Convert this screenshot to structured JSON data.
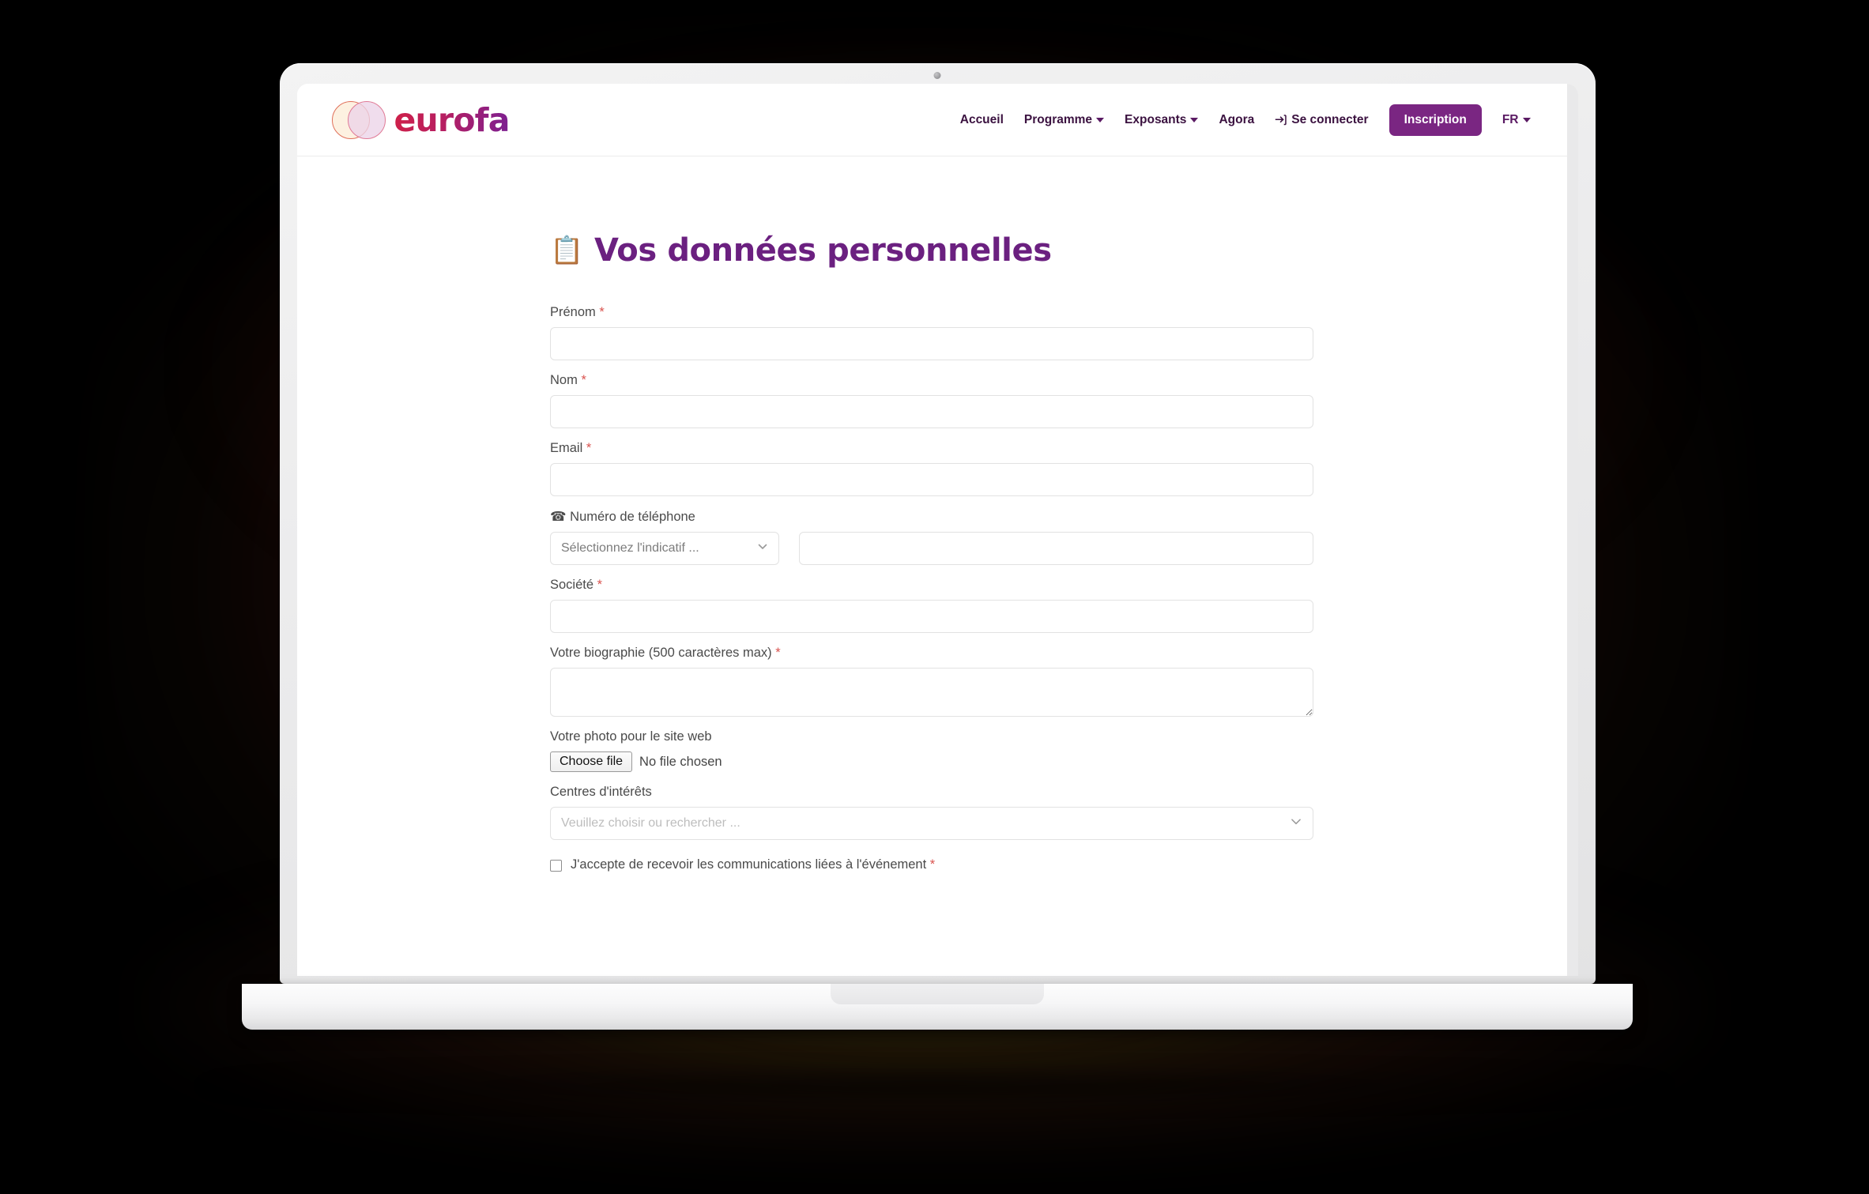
{
  "header": {
    "brand_name": "eurofa",
    "nav": [
      {
        "label": "Accueil",
        "has_caret": false
      },
      {
        "label": "Programme",
        "has_caret": true
      },
      {
        "label": "Exposants",
        "has_caret": true
      },
      {
        "label": "Agora",
        "has_caret": false
      }
    ],
    "signin_label": "Se connecter",
    "register_label": "Inscription",
    "language_label": "FR",
    "accent_color": "#7a2682"
  },
  "main": {
    "title_emoji": "📋",
    "title": "Vos données personnelles",
    "title_color": "#6b2080",
    "required_mark": "*",
    "fields": {
      "firstname": {
        "label": "Prénom",
        "required": true,
        "value": ""
      },
      "lastname": {
        "label": "Nom",
        "required": true,
        "value": ""
      },
      "email": {
        "label": "Email",
        "required": true,
        "value": ""
      },
      "phone": {
        "label": "Numéro de téléphone",
        "icon": "☎",
        "required": false,
        "country_code_value": "Sélectionnez l'indicatif ...",
        "number_value": ""
      },
      "company": {
        "label": "Société",
        "required": true,
        "value": ""
      },
      "bio": {
        "label": "Votre biographie (500 caractères max)",
        "required": true,
        "value": ""
      },
      "photo": {
        "label": "Votre photo pour le site web",
        "required": false,
        "button_label": "Choose file",
        "status": "No file chosen"
      },
      "interests": {
        "label": "Centres d'intérêts",
        "required": false,
        "placeholder": "Veuillez choisir ou rechercher ...",
        "value": ""
      },
      "consent": {
        "label": "J'accepte de recevoir les communications liées à l'événement",
        "required": true,
        "checked": false
      }
    }
  }
}
